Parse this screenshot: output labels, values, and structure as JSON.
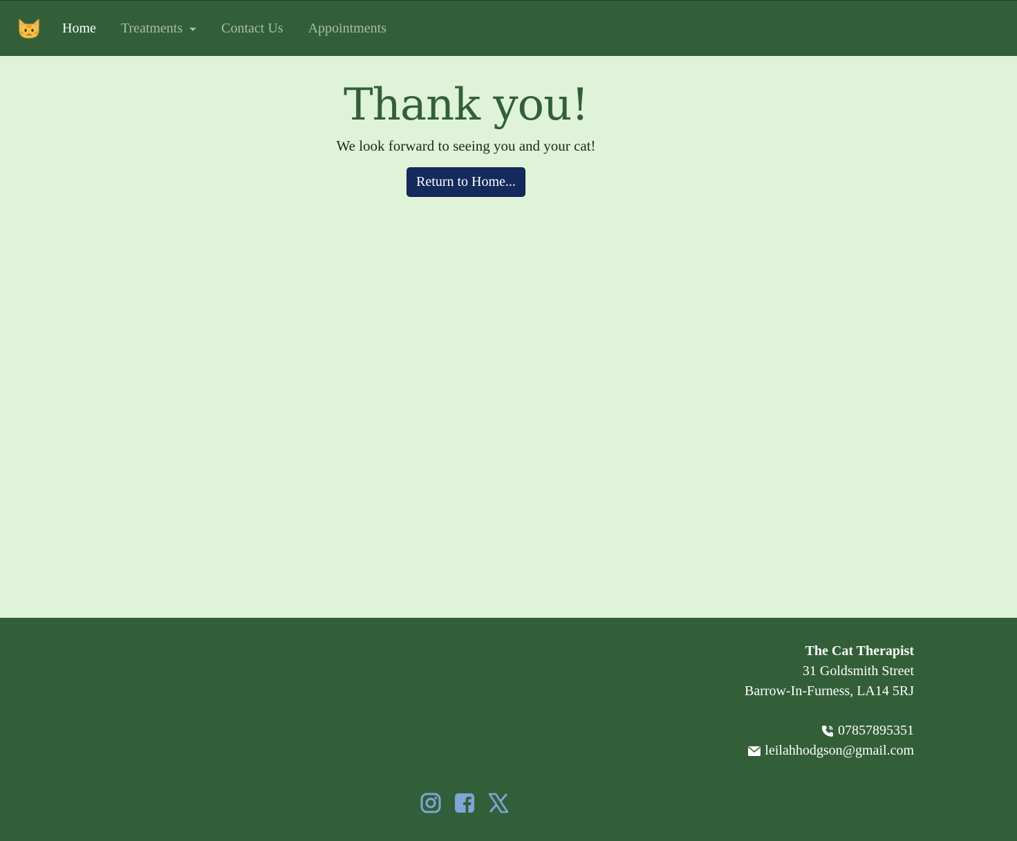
{
  "navbar": {
    "brand_icon": "cat-face-icon",
    "links": [
      {
        "label": "Home",
        "active": true
      },
      {
        "label": "Treatments",
        "dropdown": true
      },
      {
        "label": "Contact Us"
      },
      {
        "label": "Appointments"
      }
    ]
  },
  "main": {
    "title": "Thank you!",
    "subtitle": "We look forward to seeing you and your cat!",
    "button_label": "Return to Home..."
  },
  "footer": {
    "org_name": "The Cat Therapist",
    "address_line1": "31 Goldsmith Street",
    "address_line2": "Barrow-In-Furness, LA14 5RJ",
    "phone": "07857895351",
    "email": "leilahhodgson@gmail.com",
    "socials": [
      "instagram-icon",
      "facebook-icon",
      "x-icon"
    ]
  },
  "colors": {
    "nav_bg": "#325f38",
    "page_bg": "#dff3d8",
    "button_bg": "#14295c",
    "social_icon": "#7ea6d8"
  }
}
